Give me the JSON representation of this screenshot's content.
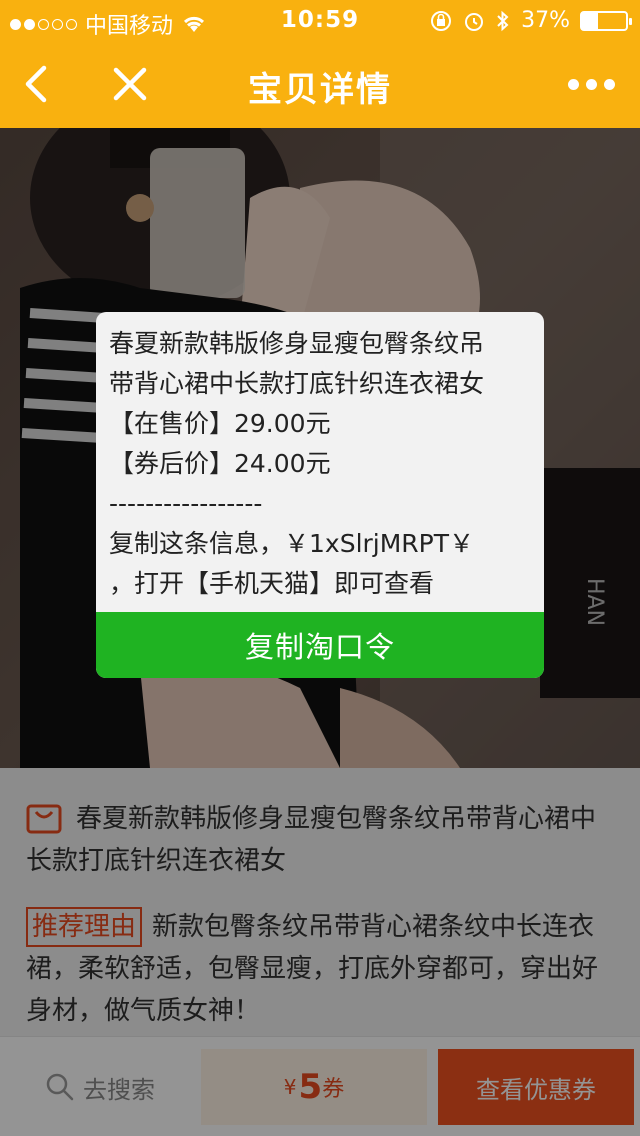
{
  "status_bar": {
    "carrier": "中国移动",
    "time": "10:59",
    "battery_percent": "37%",
    "battery_level": 0.37
  },
  "nav": {
    "title": "宝贝详情"
  },
  "product": {
    "title": "春夏新款韩版修身显瘦包臀条纹吊带背心裙中长款打底针织连衣裙女",
    "reason_tag": "推荐理由",
    "reason_text": "新款包臀条纹吊带背心裙条纹中长连衣裙，柔软舒适，包臀显瘦，打底外穿都可，穿出好身材，做气质女神！"
  },
  "popup": {
    "lines": [
      "春夏新款韩版修身显瘦包臀条纹吊",
      "带背心裙中长款打底针织连衣裙女",
      "【在售价】29.00元",
      "【券后价】24.00元",
      "-----------------",
      "复制这条信息，￥1xSlrjMRPT￥",
      "，打开【手机天猫】即可查看"
    ],
    "copy_button": "复制淘口令"
  },
  "bottom_bar": {
    "search_label": "去搜索",
    "coupon_currency": "¥",
    "coupon_amount": "5",
    "coupon_unit": "券",
    "view_coupon_label": "查看优惠券"
  },
  "colors": {
    "header": "#f9b10f",
    "accent": "#e84a1f",
    "copy_button": "#1fb322",
    "view_coupon": "#f0511f"
  }
}
